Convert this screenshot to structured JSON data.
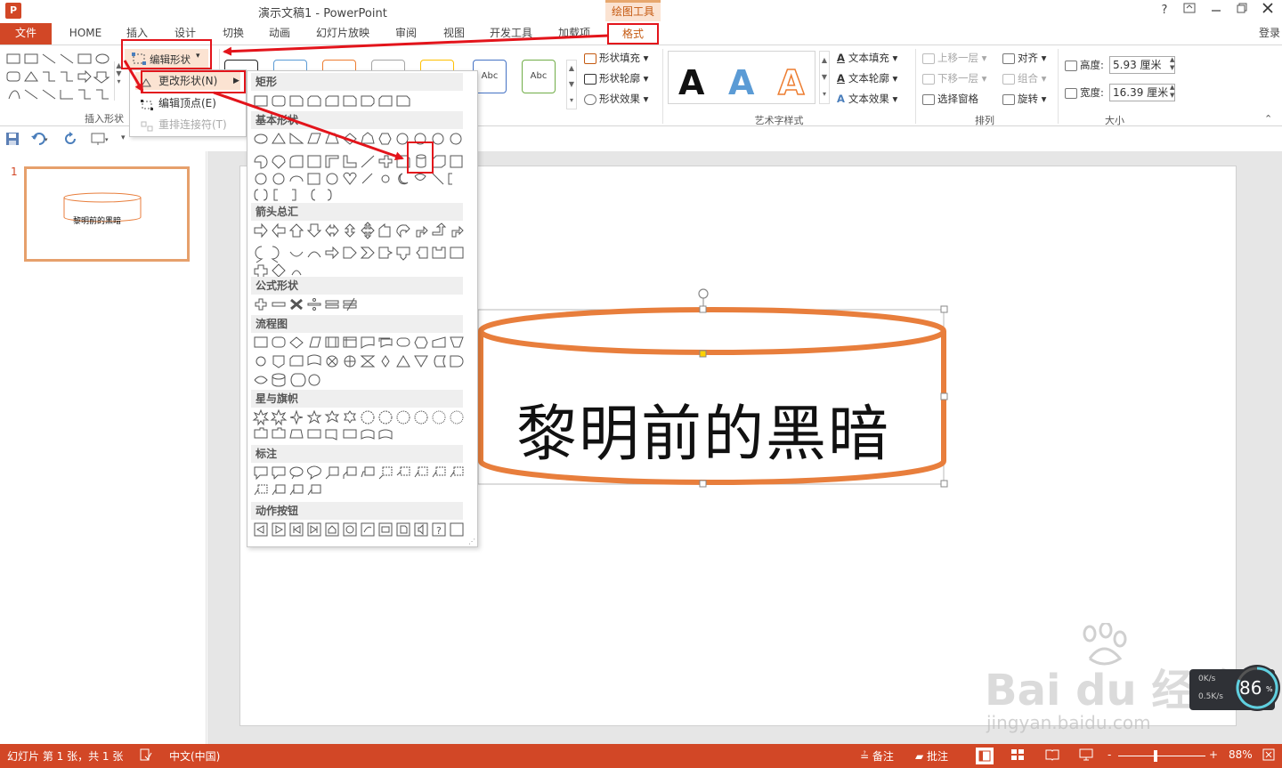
{
  "titlebar": {
    "app_logo": "P",
    "title": "演示文稿1 - PowerPoint",
    "context_tool": "绘图工具",
    "help": "?"
  },
  "tabs": [
    {
      "label": "文件"
    },
    {
      "label": "HOME"
    },
    {
      "label": "插入"
    },
    {
      "label": "设计"
    },
    {
      "label": "切换"
    },
    {
      "label": "动画"
    },
    {
      "label": "幻灯片放映"
    },
    {
      "label": "审阅"
    },
    {
      "label": "视图"
    },
    {
      "label": "开发工具"
    },
    {
      "label": "加载项"
    },
    {
      "label": "格式"
    }
  ],
  "login": "登录",
  "ribbon": {
    "insert_shapes_label": "插入形状",
    "edit_shape_button": "编辑形状",
    "shape_style_abc_1": "Abc",
    "shape_style_abc_2": "Abc",
    "shape_fill": "形状填充",
    "shape_outline": "形状轮廓",
    "shape_effects": "形状效果",
    "wordart_a": "A",
    "wordart_label": "艺术字样式",
    "text_fill": "文本填充",
    "text_outline": "文本轮廓",
    "text_effects": "文本效果",
    "arrange_label": "排列",
    "bring_forward": "上移一层",
    "send_backward": "下移一层",
    "selection_pane": "选择窗格",
    "align": "对齐",
    "group": "组合",
    "rotate": "旋转",
    "size_label": "大小",
    "height_label": "高度:",
    "height_value": "5.93 厘米",
    "width_label": "宽度:",
    "width_value": "16.39 厘米"
  },
  "context_menu": {
    "change_shape": "更改形状(N)",
    "edit_points": "编辑顶点(E)",
    "reroute": "重排连接符(T)"
  },
  "shape_menu": {
    "categories": [
      "矩形",
      "基本形状",
      "箭头总汇",
      "公式形状",
      "流程图",
      "星与旗帜",
      "标注",
      "动作按钮"
    ]
  },
  "slide_panel": {
    "slide_number": "1",
    "thumb_text": "黎明前的黑暗"
  },
  "slide": {
    "text": "黎明前的黑暗"
  },
  "statusbar": {
    "slide_info": "幻灯片 第 1 张，共 1 张",
    "language": "中文(中国)",
    "notes": "备注",
    "comments": "批注",
    "zoom": "88%",
    "zoom_minus": "-",
    "zoom_plus": "+"
  },
  "speed_widget": {
    "up": "0K/s",
    "down": "0.5K/s",
    "percent": "86",
    "unit": "%"
  },
  "watermark": {
    "brand": "Bai du 经验",
    "url": "jingyan.baidu.com"
  },
  "colors": {
    "accent": "#d24726",
    "shape_outline": "#e87e3c",
    "annotation_red": "#e3141b",
    "context_tab": "#c55a11"
  }
}
